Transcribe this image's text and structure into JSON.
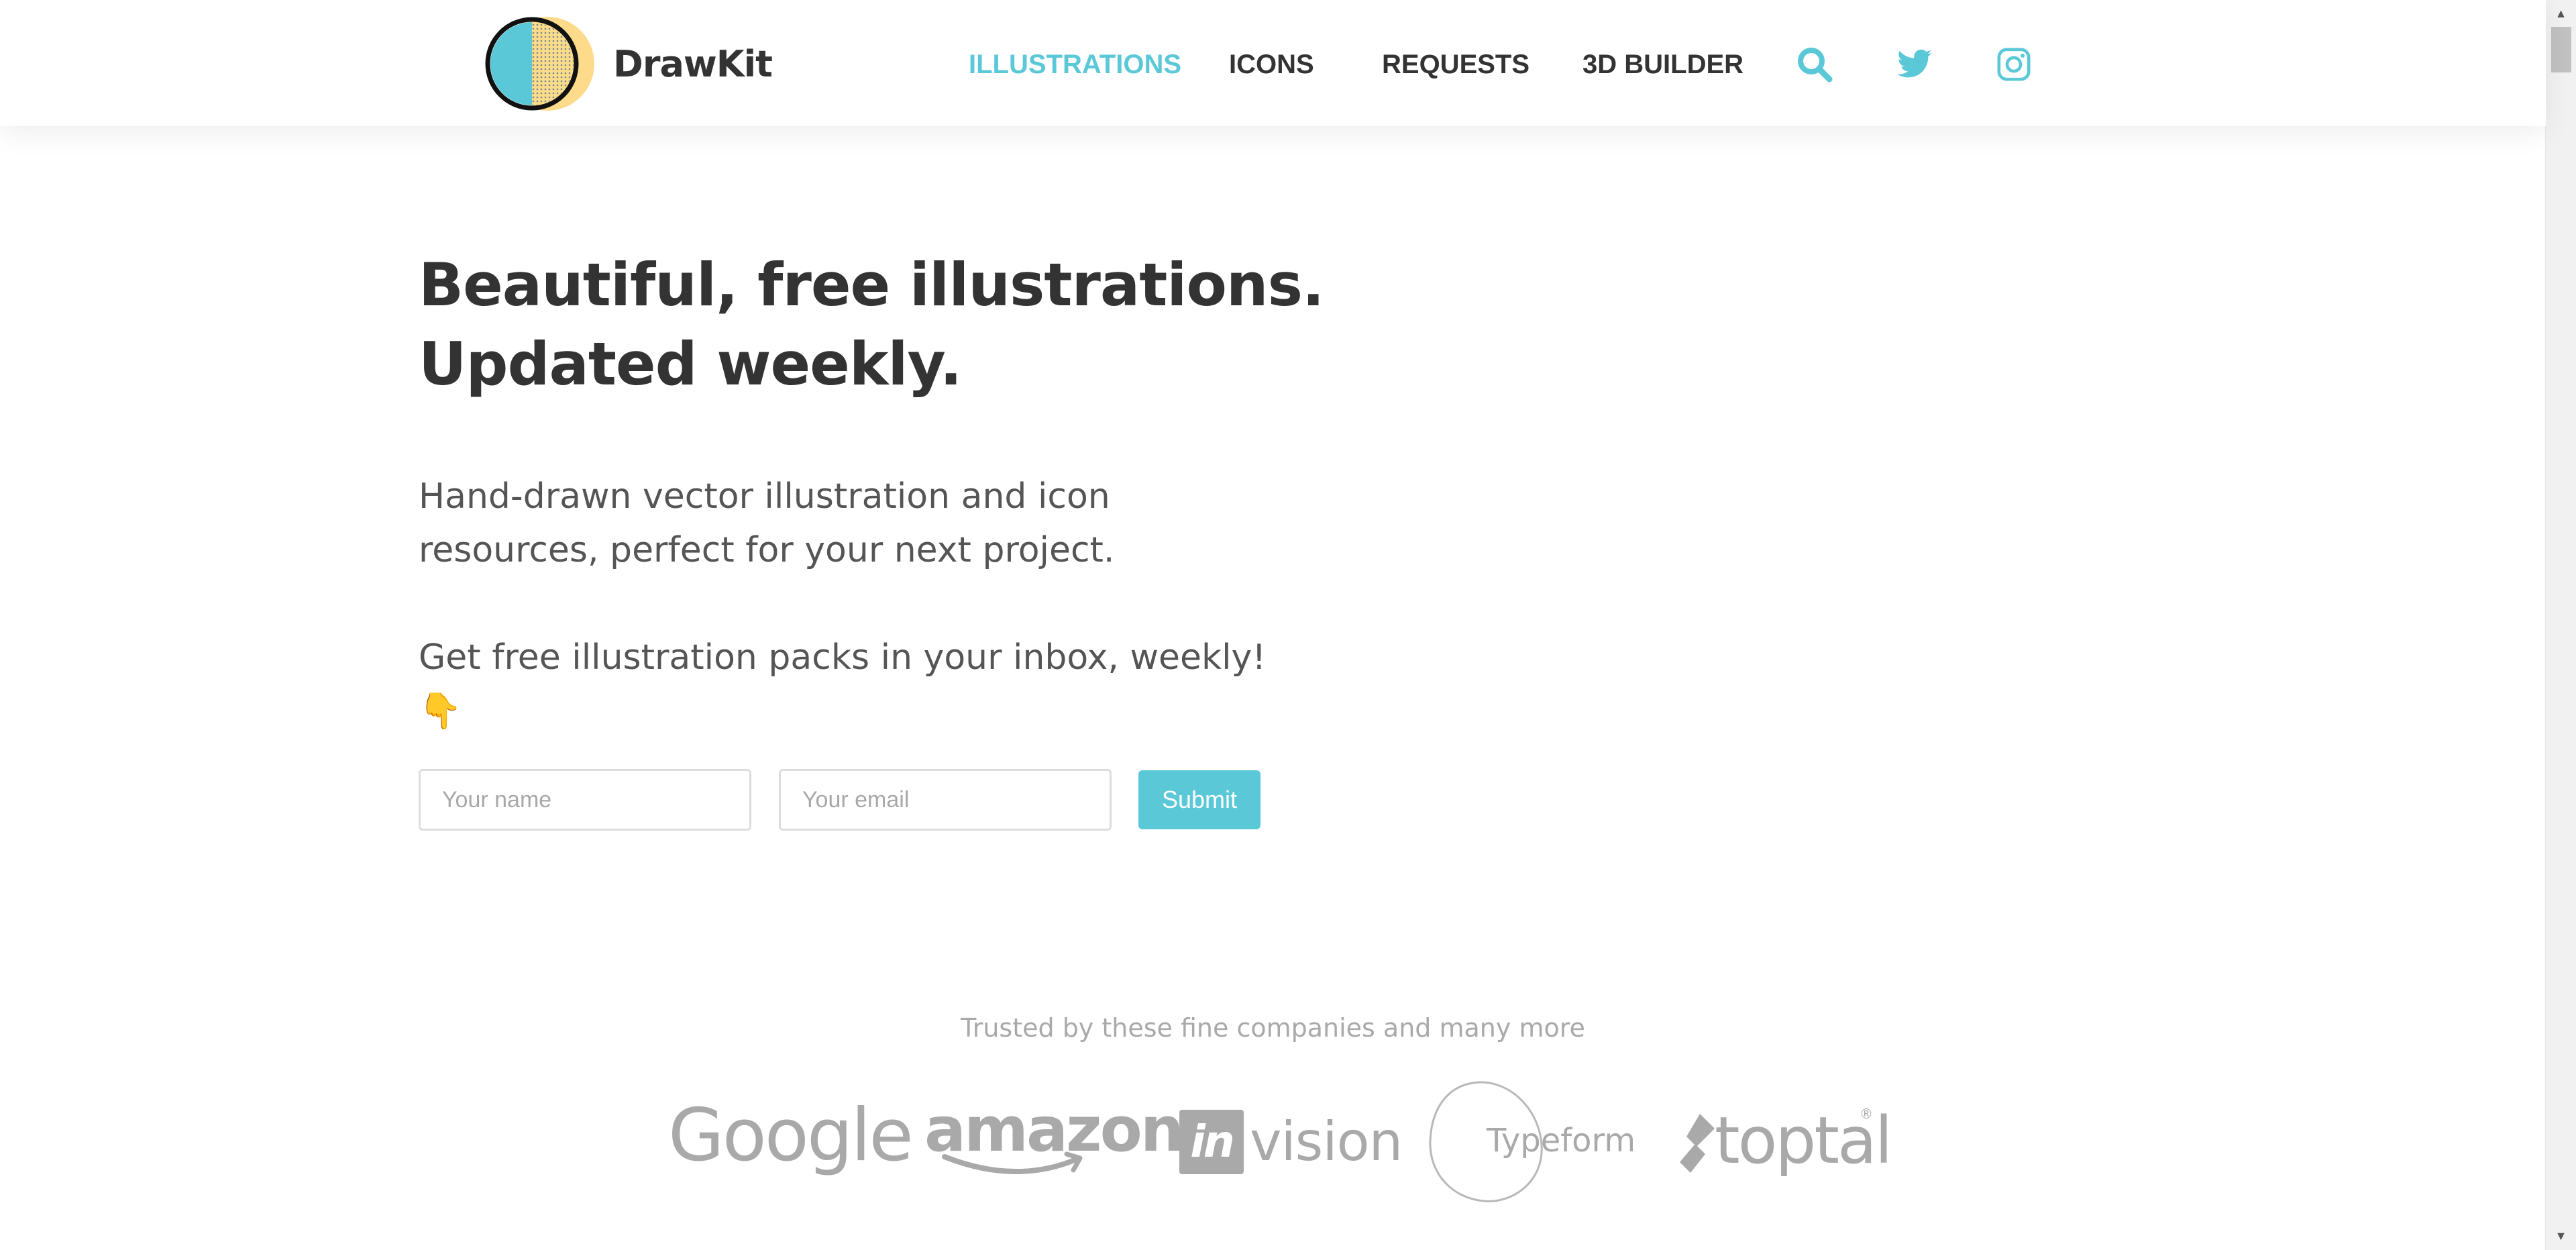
{
  "brand": {
    "name": "DrawKit"
  },
  "nav": {
    "items": [
      {
        "label": "ILLUSTRATIONS",
        "active": true
      },
      {
        "label": "ICONS",
        "active": false
      },
      {
        "label": "REQUESTS",
        "active": false
      },
      {
        "label": "3D BUILDER",
        "active": false
      }
    ],
    "icons": [
      "search-icon",
      "twitter-icon",
      "instagram-icon"
    ]
  },
  "hero": {
    "title_lines": [
      "Beautiful, free illustrations.",
      "Updated weekly."
    ],
    "subtitle_lines": [
      "Hand-drawn vector illustration and icon",
      "resources, perfect for your next project."
    ],
    "cta_line": "Get free illustration packs in your inbox, weekly!",
    "cta_emoji": "👇"
  },
  "form": {
    "name_placeholder": "Your name",
    "email_placeholder": "Your email",
    "submit_label": "Submit"
  },
  "trusted": {
    "text": "Trusted by these fine companies and many more",
    "companies": [
      "Google",
      "amazon",
      "in",
      "vision",
      "Typeform",
      "toptal",
      "®"
    ]
  },
  "colors": {
    "accent": "#5bc8d8",
    "text_dark": "#333333",
    "text_body": "#555555",
    "muted": "#a9a9a9",
    "logo_yellow": "#fddb8a"
  }
}
